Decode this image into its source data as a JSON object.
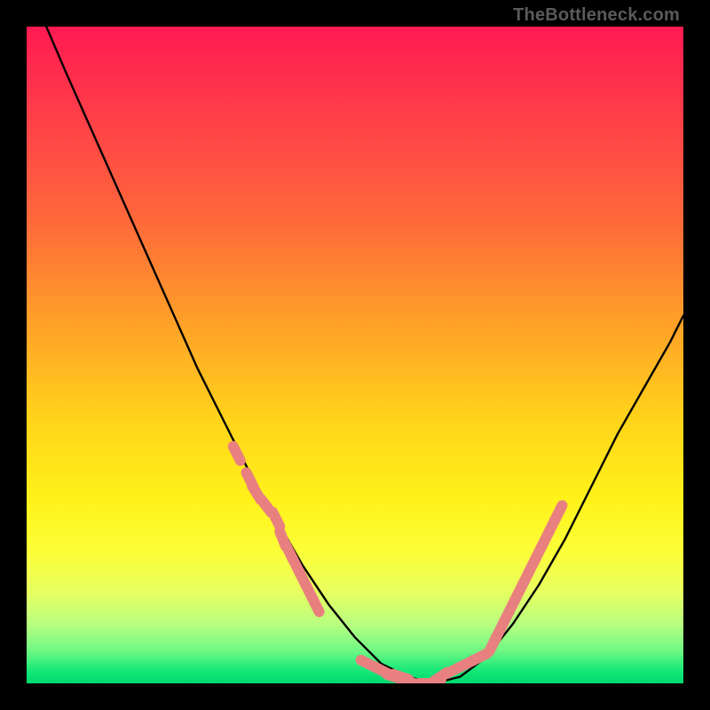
{
  "watermark": "TheBottleneck.com",
  "colors": {
    "curve": "#000000",
    "marker_fill": "#e98080",
    "marker_stroke": "#d86868"
  },
  "chart_data": {
    "type": "line",
    "title": "",
    "xlabel": "",
    "ylabel": "",
    "xlim": [
      0,
      100
    ],
    "ylim": [
      0,
      100
    ],
    "grid": false,
    "legend": false,
    "series": [
      {
        "name": "curve",
        "x": [
          3,
          6,
          10,
          14,
          18,
          22,
          26,
          30,
          34,
          38,
          42,
          46,
          50,
          54,
          58,
          62,
          66,
          70,
          74,
          78,
          82,
          86,
          90,
          94,
          98,
          100
        ],
        "y": [
          100,
          93,
          84,
          75,
          66,
          57,
          48,
          40,
          32,
          25,
          18,
          12,
          7,
          3,
          1,
          0,
          1,
          4,
          9,
          15,
          22,
          30,
          38,
          45,
          52,
          56
        ]
      }
    ],
    "markers": {
      "left_cluster": {
        "x": [
          32,
          34,
          35,
          36.5,
          38,
          39,
          40,
          41,
          42,
          43,
          44
        ],
        "y": [
          35,
          31,
          29,
          27,
          25,
          22,
          20,
          18,
          16,
          14,
          12
        ]
      },
      "bottom_cluster": {
        "x": [
          52,
          54,
          56,
          57,
          59,
          61,
          62,
          63,
          65,
          67,
          69
        ],
        "y": [
          3,
          2,
          1,
          1,
          0,
          0,
          0,
          1,
          2,
          3,
          4
        ]
      },
      "right_cluster": {
        "x": [
          71,
          72,
          73,
          74,
          75,
          76,
          77,
          78,
          79,
          80,
          81
        ],
        "y": [
          6,
          8,
          10,
          12,
          14,
          16,
          18,
          20,
          22,
          24,
          26
        ]
      }
    }
  }
}
